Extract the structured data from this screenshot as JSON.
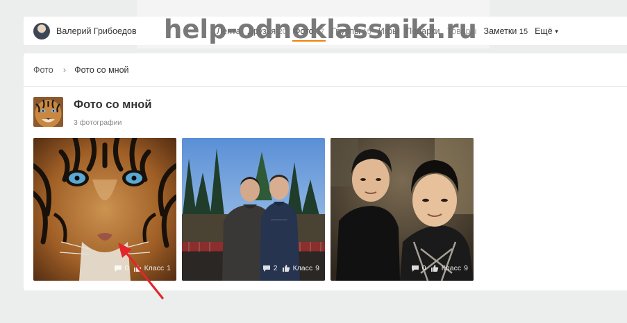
{
  "header": {
    "user_name": "Валерий Грибоедов",
    "menu": [
      {
        "label": "Лента",
        "count": ""
      },
      {
        "label": "Друзья",
        "count": "20"
      },
      {
        "label": "Фото",
        "count": "37"
      },
      {
        "label": "Группы",
        "count": "15"
      },
      {
        "label": "Игры",
        "count": ""
      },
      {
        "label": "Подарки",
        "count": ""
      },
      {
        "label": "Товары",
        "count": ""
      },
      {
        "label": "Заметки",
        "count": "15"
      },
      {
        "label": "Ещё",
        "count": ""
      }
    ],
    "active_index": 2
  },
  "watermark": "help-odnoklassniki.ru",
  "breadcrumb": {
    "root": "Фото",
    "current": "Фото со мной"
  },
  "album": {
    "title": "Фото со мной",
    "count_text": "3 фотографии"
  },
  "photos": [
    {
      "subject": "tiger",
      "comments": "0",
      "like_label": "Класс",
      "likes": "1"
    },
    {
      "subject": "two-men-outdoors",
      "comments": "2",
      "like_label": "Класс",
      "likes": "9"
    },
    {
      "subject": "two-men-selfie",
      "comments": "0",
      "like_label": "Класс",
      "likes": "9"
    }
  ],
  "colors": {
    "accent": "#ee8208",
    "arrow": "#e3252b",
    "page_bg": "#eceded"
  }
}
